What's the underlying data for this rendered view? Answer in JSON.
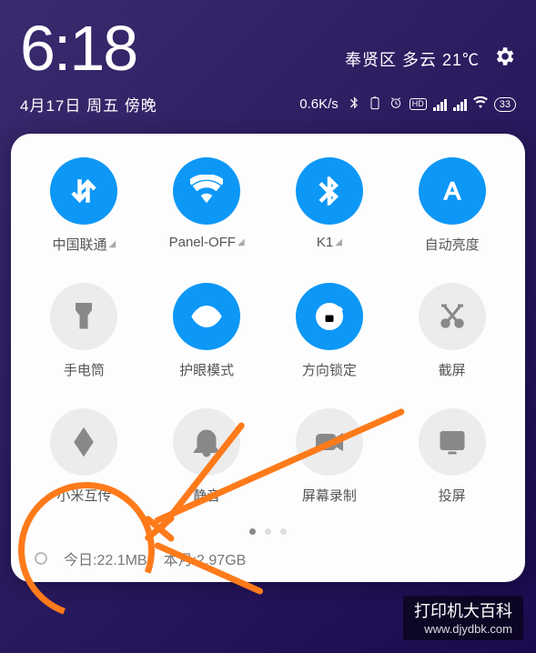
{
  "status": {
    "time": "6:18",
    "weather": "奉贤区 多云 21℃",
    "date": "4月17日 周五 傍晚",
    "net_speed": "0.6K/s",
    "battery": "33"
  },
  "tiles": [
    {
      "id": "mobile-data",
      "icon": "data-arrows",
      "label": "中国联通",
      "on": true,
      "chevron": true
    },
    {
      "id": "wifi",
      "icon": "wifi",
      "label": "Panel-OFF",
      "on": true,
      "chevron": true
    },
    {
      "id": "bluetooth",
      "icon": "bluetooth",
      "label": "K1",
      "on": true,
      "chevron": true
    },
    {
      "id": "auto-brightness",
      "icon": "letter-a",
      "label": "自动亮度",
      "on": true,
      "chevron": false
    },
    {
      "id": "flashlight",
      "icon": "flashlight",
      "label": "手电筒",
      "on": false,
      "chevron": false
    },
    {
      "id": "eye-protect",
      "icon": "eye",
      "label": "护眼模式",
      "on": true,
      "chevron": false
    },
    {
      "id": "rotation-lock",
      "icon": "lock-rotate",
      "label": "方向锁定",
      "on": true,
      "chevron": false
    },
    {
      "id": "screenshot",
      "icon": "scissors",
      "label": "截屏",
      "on": false,
      "chevron": false
    },
    {
      "id": "mi-share",
      "icon": "mi-share",
      "label": "小米互传",
      "on": false,
      "chevron": false
    },
    {
      "id": "mute",
      "icon": "bell",
      "label": "静音",
      "on": false,
      "chevron": false
    },
    {
      "id": "screen-record",
      "icon": "video",
      "label": "屏幕录制",
      "on": false,
      "chevron": false
    },
    {
      "id": "cast",
      "icon": "cast",
      "label": "投屏",
      "on": false,
      "chevron": false
    }
  ],
  "pagination": {
    "pages": 3,
    "active": 0
  },
  "data_usage": {
    "today_label": "今日:",
    "today_value": "22.1MB",
    "month_label": "本月:",
    "month_value": "2.97GB"
  },
  "watermark": {
    "title": "打印机大百科",
    "url": "www.djydbk.com"
  },
  "annotation": {
    "target_tile": "mi-share",
    "color": "#ff7a1a"
  }
}
